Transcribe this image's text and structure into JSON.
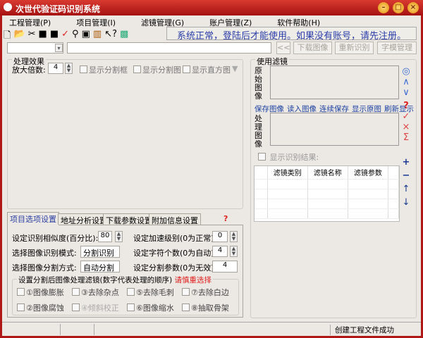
{
  "window": {
    "title": "次世代验证码识别系统",
    "colors": {
      "titlebar": "#c02020",
      "link": "#1a3fa0",
      "warn": "#e02020"
    }
  },
  "menu": [
    "工程管理(P)",
    "项目管理(I)",
    "滤镜管理(G)",
    "账户管理(Z)",
    "软件帮助(H)"
  ],
  "toolbar": {
    "icons": [
      "new-file-icon",
      "open-folder-icon",
      "cut-icon",
      "save-icon",
      "save-as-icon",
      "check-icon",
      "binoculars-icon",
      "search-window-icon",
      "books-icon",
      "help-pointer-icon",
      "image-icon"
    ],
    "status_message": "系统正常，登陆后才能使用。如果没有账号，请先注册。"
  },
  "address_row": {
    "combo_value": "",
    "url_value": "",
    "back_label": "<<",
    "download_label": "下载图像",
    "rerecognize_label": "重新识别",
    "font_manage_label": "字模管理"
  },
  "effects": {
    "title": "处理效果",
    "zoom_label": "放大倍数:",
    "zoom_value": "4",
    "show_seg_frame": "显示分割框",
    "show_seg_image": "显示分割图",
    "show_histogram": "显示直方图"
  },
  "tabs": [
    "项目选项设置",
    "地址分析设置",
    "下载参数设置",
    "附加信息设置"
  ],
  "settings": {
    "similarity_label": "设定识别相似度(百分比):",
    "similarity_value": "80",
    "mode_label": "选择图像识别模式:",
    "mode_value": "分割识别",
    "split_label": "选择图像分割方式:",
    "split_value": "自动分割",
    "accel_label": "设定加速级别(0为正常):",
    "accel_value": "0",
    "chars_label": "设定字符个数(0为自动):",
    "chars_value": "4",
    "split_param_label": "设定分割参数(0为无效):",
    "split_param_value": "4",
    "filter_group_title": "设置分割后图像处理滤镜(数字代表处理的顺序)",
    "filter_warning": "请慎重选择",
    "filters": [
      "①图像膨胀",
      "③去除杂点",
      "⑤去除毛刺",
      "⑦去除白边",
      "②图像腐蚀",
      "④倾斜校正",
      "⑥图像缩水",
      "⑧抽取骨架"
    ]
  },
  "filter_panel": {
    "title": "使用滤镜",
    "original_label": "原始图像",
    "processed_label": "处理图像",
    "links": [
      "保存图像",
      "读入图像",
      "连续保存",
      "显示原图",
      "刷新显示"
    ],
    "show_result_label": "显示识别结果:",
    "columns": [
      "滤镜类别",
      "滤镜名称",
      "滤镜参数"
    ]
  },
  "statusbar": {
    "message": "创建工程文件成功"
  }
}
